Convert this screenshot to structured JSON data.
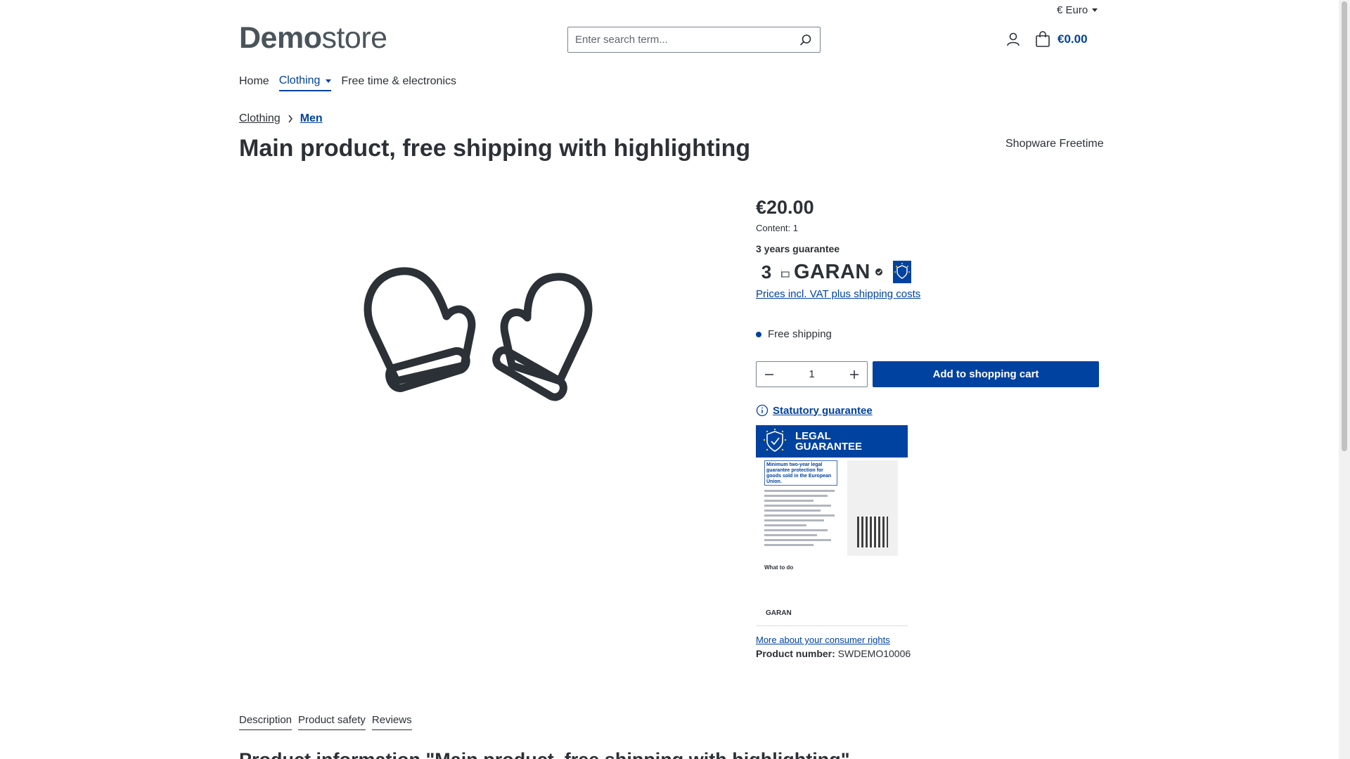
{
  "header": {
    "currency_label": "€ Euro",
    "logo_bold": "Demo",
    "logo_light": "store",
    "search_placeholder": "Enter search term...",
    "cart_total": "€0.00"
  },
  "nav": {
    "items": [
      {
        "label": "Home"
      },
      {
        "label": "Clothing"
      },
      {
        "label": "Free time & electronics"
      }
    ]
  },
  "breadcrumb": [
    "Clothing",
    "Men"
  ],
  "product": {
    "title": "Main product, free shipping with highlighting",
    "manufacturer": "Shopware Freetime",
    "price": "€20.00",
    "content": "Content: 1",
    "guarantee_heading": "3 years guarantee",
    "guarantee_years": "3",
    "guarantee_word": "GARAN",
    "vat_link": "Prices incl. VAT plus shipping costs",
    "shipping": "Free shipping",
    "quantity": "1",
    "add_to_cart": "Add to shopping cart",
    "statutory_link": "Statutory guarantee",
    "legal_title_1": "LEGAL",
    "legal_title_2": "GUARANTEE",
    "legal_box_text": "Minimum two-year legal guarantee protection for goods sold in the European Union.",
    "legal_what": "What to do",
    "legal_garan": "GARAN",
    "consumer_link": "More about your consumer rights",
    "product_number_label": "Product number:",
    "product_number": "SWDEMO10006"
  },
  "tabs": [
    "Description",
    "Product safety",
    "Reviews"
  ],
  "description_heading": "Product information \"Main product, free shipping with highlighting\"",
  "colors": {
    "accent": "#0042a0",
    "text": "#2b3136"
  }
}
